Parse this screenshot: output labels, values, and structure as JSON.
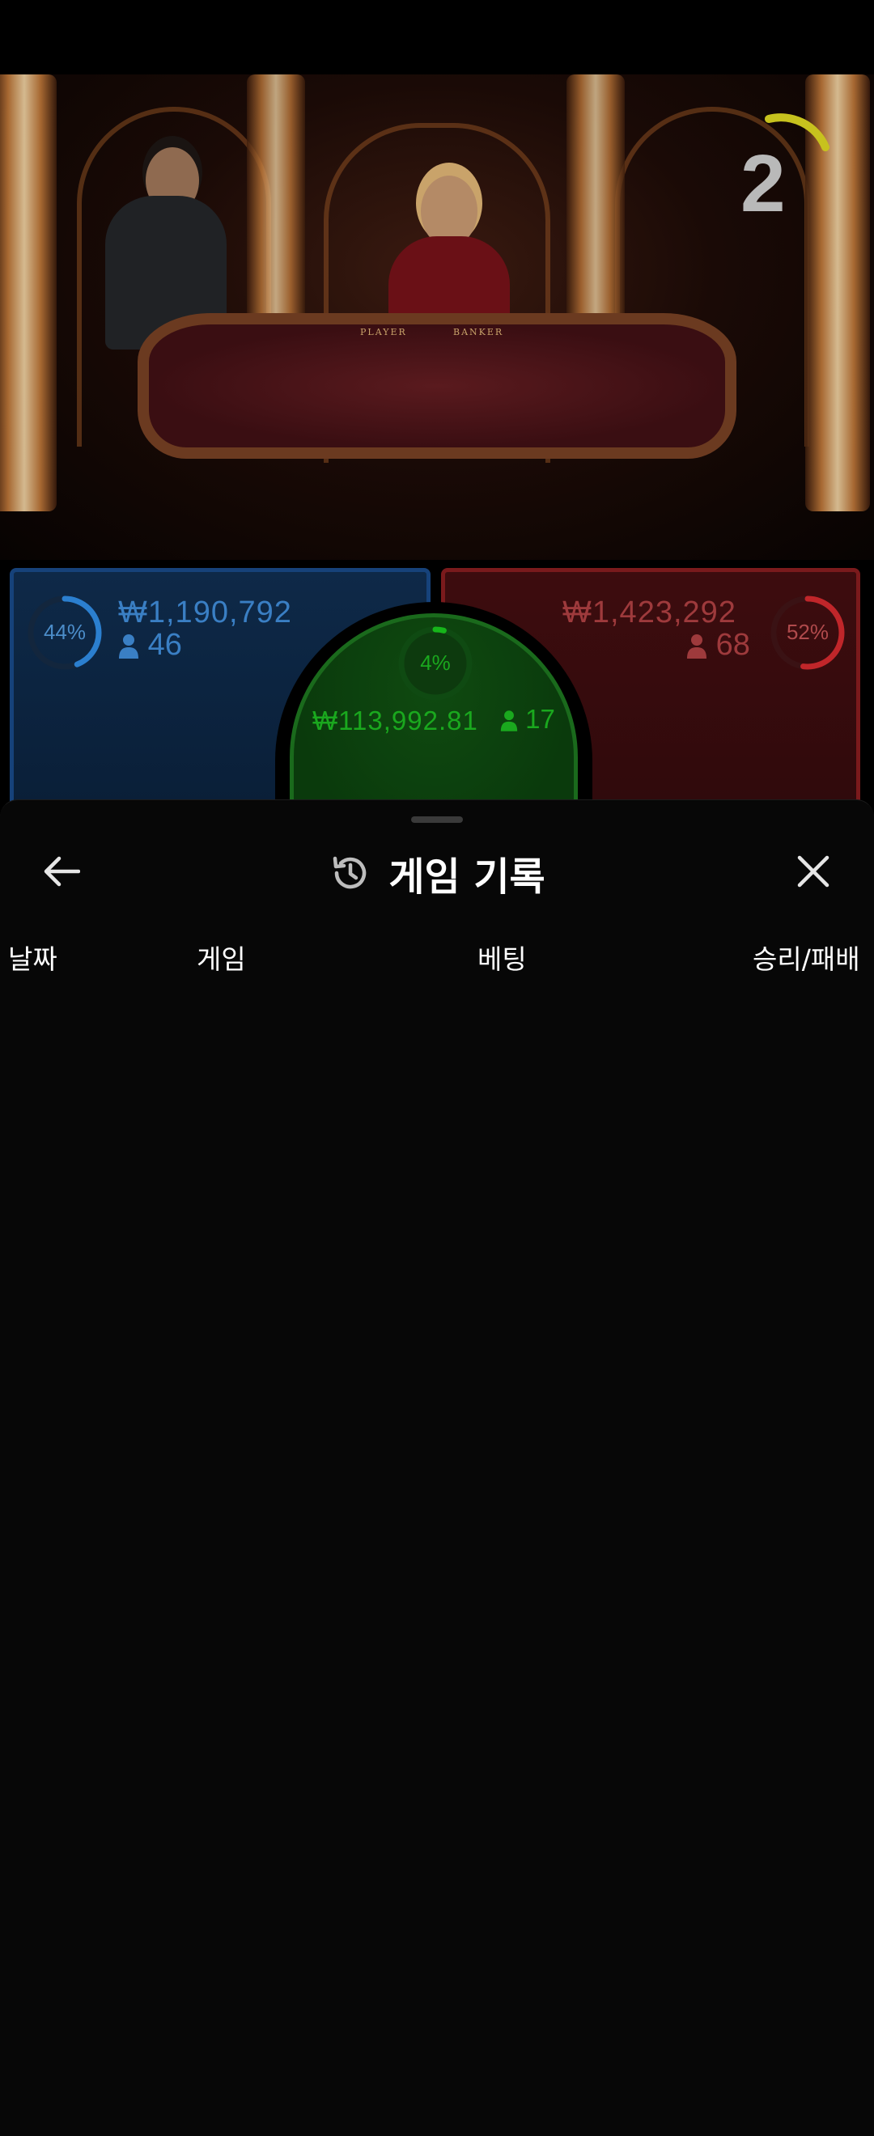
{
  "video": {
    "countdown": "2",
    "table_labels": {
      "player": "PLAYER",
      "banker": "BANKER"
    }
  },
  "betting": {
    "player": {
      "percent_label": "44%",
      "percent_value": 0.44,
      "amount": "₩1,190,792",
      "players": "46",
      "color": "#2b7fcf"
    },
    "banker": {
      "percent_label": "52%",
      "percent_value": 0.52,
      "amount": "₩1,423,292",
      "players": "68",
      "color": "#c0262a"
    },
    "tie": {
      "percent_label": "4%",
      "percent_value": 0.04,
      "amount": "₩113,992.81",
      "players": "17",
      "color": "#16b51a"
    }
  },
  "history": {
    "title": "게임 기록",
    "columns": [
      "날짜",
      "게임",
      "베팅",
      "승리/패배"
    ],
    "rows": []
  },
  "icons": {
    "back": "arrow-left-icon",
    "history": "history-icon",
    "close": "close-icon",
    "person": "person-icon"
  }
}
